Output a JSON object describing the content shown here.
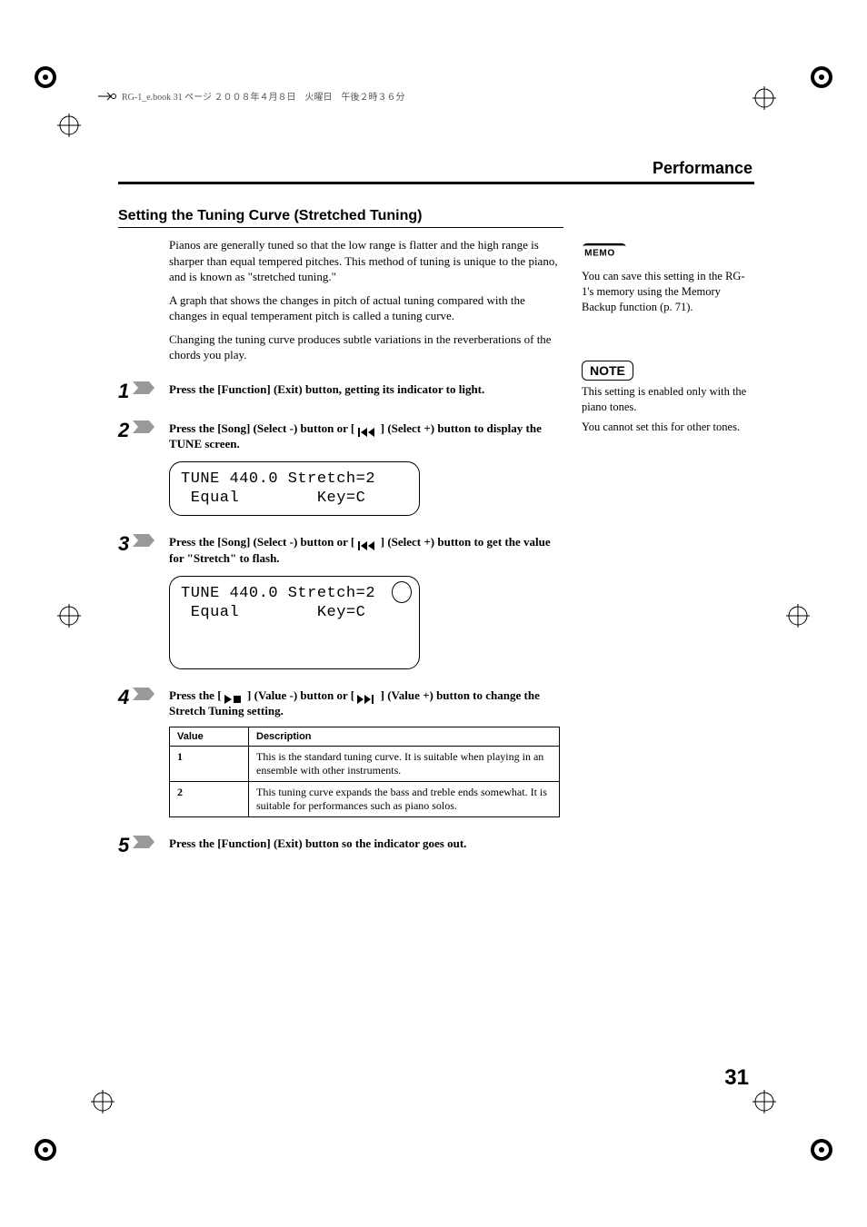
{
  "header_line": "RG-1_e.book 31 ページ ２００８年４月８日　火曜日　午後２時３６分",
  "performance_heading": "Performance",
  "section_title": "Setting the Tuning Curve (Stretched Tuning)",
  "intro_paragraphs": [
    "Pianos are generally tuned so that the low range is flatter and the high range is sharper than equal tempered pitches. This method of tuning is unique to the piano, and is known as \"stretched tuning.\"",
    "A graph that shows the changes in pitch of actual tuning compared with the changes in equal temperament pitch is called a tuning curve.",
    "Changing the tuning curve produces subtle variations in the reverberations of the chords you play."
  ],
  "steps": [
    {
      "num": "1",
      "text": "Press the [Function] (Exit) button, getting its indicator to light."
    },
    {
      "num": "2",
      "pre": "Press the [Song] (Select -) button or [ ",
      "post": " ] (Select +) button to display the TUNE screen."
    },
    {
      "num": "3",
      "pre": "Press the [Song] (Select -) button or [ ",
      "post": " ] (Select +) button to get the value for \"Stretch\" to flash."
    },
    {
      "num": "4",
      "pre": "Press the [ ",
      "mid": " ] (Value -) button or [ ",
      "post": " ] (Value +) button to change the Stretch Tuning setting."
    },
    {
      "num": "5",
      "text": "Press the [Function] (Exit) button so the indicator goes out."
    }
  ],
  "lcd1": {
    "line1": "TUNE 440.0 Stretch=2",
    "line2": " Equal        Key=C"
  },
  "lcd2": {
    "line1": "TUNE 440.0 Stretch=2",
    "line2": " Equal        Key=C"
  },
  "table": {
    "headers": [
      "Value",
      "Description"
    ],
    "rows": [
      {
        "value": "1",
        "desc": "This is the standard tuning curve.\nIt is suitable when playing in an ensemble with other instruments."
      },
      {
        "value": "2",
        "desc": "This tuning curve expands the bass and treble ends somewhat. It is suitable for performances such as piano solos."
      }
    ]
  },
  "memo_text": "You can save this setting in the RG-1's memory using the Memory Backup function (p. 71).",
  "note_label": "NOTE",
  "note_text1": "This setting is enabled only with the piano tones.",
  "note_text2": "You cannot set this for other tones.",
  "page_number": "31"
}
